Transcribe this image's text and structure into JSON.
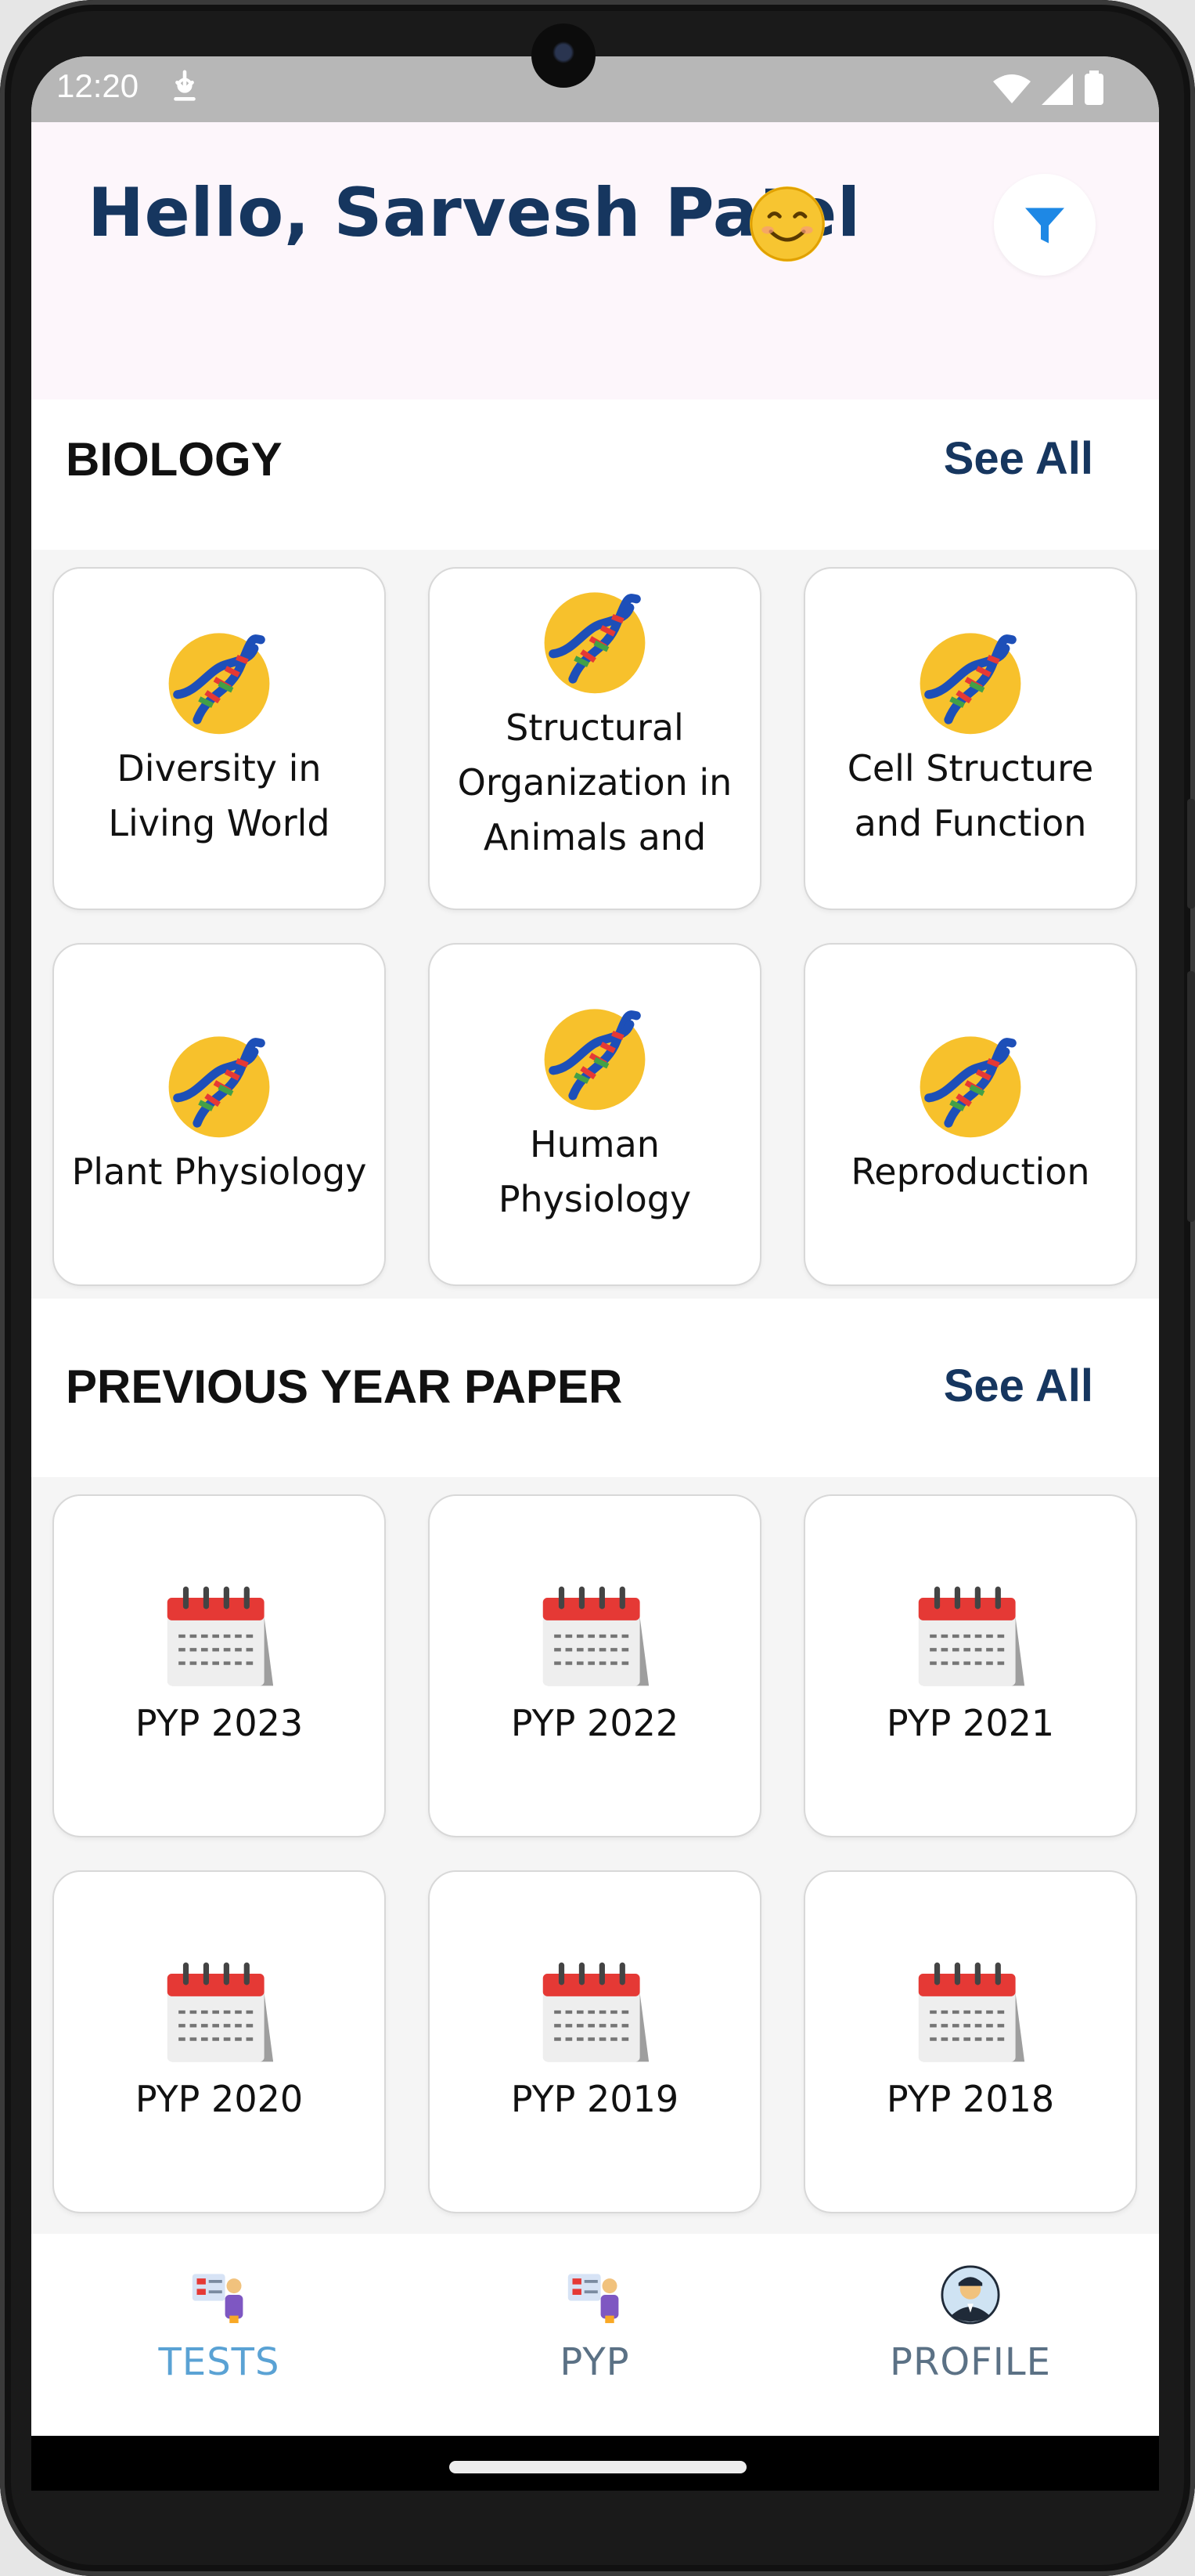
{
  "status_bar": {
    "time": "12:20"
  },
  "header": {
    "greeting": "Hello, Sarvesh Patel"
  },
  "biology": {
    "title": "BIOLOGY",
    "see_all": "See All",
    "items": [
      {
        "label": "Diversity in Living World"
      },
      {
        "label": "Structural Organization in Animals and"
      },
      {
        "label": "Cell Structure and Function"
      },
      {
        "label": "Plant Physiology"
      },
      {
        "label": "Human Physiology"
      },
      {
        "label": "Reproduction"
      }
    ]
  },
  "pyp": {
    "title": "PREVIOUS YEAR PAPER",
    "see_all": "See All",
    "items": [
      {
        "label": "PYP 2023"
      },
      {
        "label": "PYP 2022"
      },
      {
        "label": "PYP 2021"
      },
      {
        "label": "PYP 2020"
      },
      {
        "label": "PYP 2019"
      },
      {
        "label": "PYP 2018"
      }
    ]
  },
  "bottom_nav": {
    "items": [
      {
        "label": "TESTS",
        "active": true,
        "icon": "tests-icon"
      },
      {
        "label": "PYP",
        "active": false,
        "icon": "pyp-icon"
      },
      {
        "label": "PROFILE",
        "active": false,
        "icon": "profile-avatar-icon"
      }
    ]
  },
  "colors": {
    "accent_dark": "#16365f",
    "nav_active": "#5aa2d4",
    "nav_inactive": "#5b7185",
    "filter": "#1e88e5"
  }
}
